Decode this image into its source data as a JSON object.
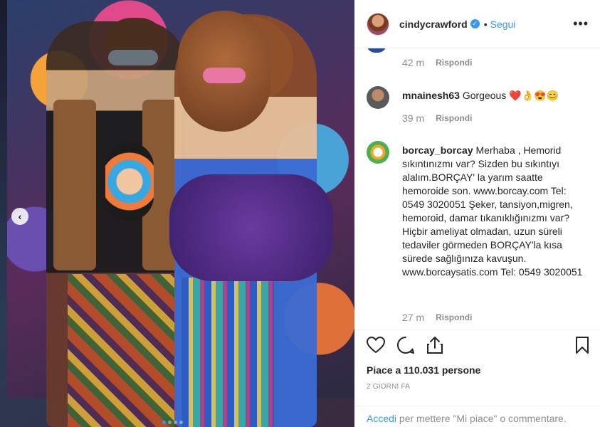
{
  "post": {
    "username": "cindycrawford",
    "verified_mark": "✓",
    "separator": "•",
    "follow_label": "Segui",
    "more_label": "•••"
  },
  "photo": {
    "prev_arrow": "‹",
    "carousel_dots": 4,
    "active_dot": 0
  },
  "comments": [
    {
      "time": "42 m",
      "reply": "Rispondi"
    },
    {
      "username": "mnainesh63",
      "text": "Gorgeous ❤️👌😍😊",
      "time": "39 m",
      "reply": "Rispondi"
    },
    {
      "username": "borcay_borcay",
      "text": "Merhaba , Hemorid sıkıntınızmı var? Sizden bu sıkıntıyı alalım.BORÇAY' la yarım saatte hemoroide son. www.borcay.com Tel: 0549 3020051 Şeker, tansiyon,migren, hemoroid, damar tıkanıklığınızmı var? Hiçbir ameliyat olmadan, uzun süreli tedaviler görmeden BORÇAY'la kısa sürede sağlığınıza kavuşun. www.borcaysatis.com Tel: 0549 3020051",
      "time": "27 m",
      "reply": "Rispondi"
    }
  ],
  "actions": {
    "like_icon": "heart-icon",
    "comment_icon": "comment-icon",
    "share_icon": "share-icon",
    "save_icon": "bookmark-icon",
    "likes_text": "Piace a 110.031 persone",
    "date": "2 GIORNI FA"
  },
  "login": {
    "link": "Accedi",
    "rest": " per mettere \"Mi piace\" o commentare."
  },
  "colors": {
    "accent": "#3897f0",
    "text": "#262626",
    "muted": "#8e8e8e",
    "border": "#efefef"
  }
}
